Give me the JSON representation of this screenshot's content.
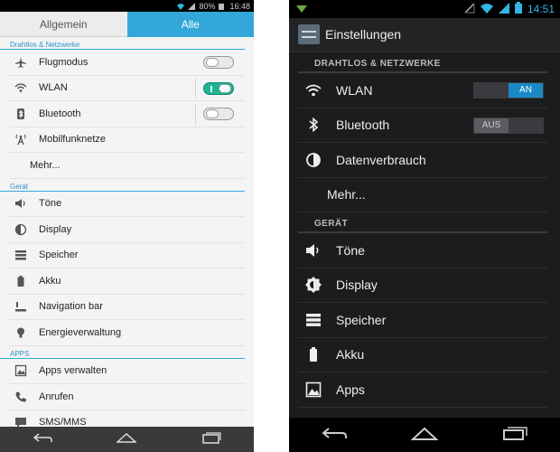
{
  "left": {
    "status": {
      "battery_percent": "80%",
      "time": "16:48"
    },
    "tabs": [
      {
        "label": "Allgemein"
      },
      {
        "label": "Alle"
      }
    ],
    "sections": {
      "network": "Drahtlos & Netzwerke",
      "device": "Gerät",
      "apps": "APPS"
    },
    "items": {
      "airplane": {
        "label": "Flugmodus",
        "icon": "airplane-icon"
      },
      "wlan": {
        "label": "WLAN",
        "icon": "wifi-icon"
      },
      "bluetooth": {
        "label": "Bluetooth",
        "icon": "bluetooth-icon"
      },
      "mobile": {
        "label": "Mobilfunknetze",
        "icon": "antenna-icon"
      },
      "more": {
        "label": "Mehr..."
      },
      "tones": {
        "label": "Töne",
        "icon": "speaker-icon"
      },
      "display": {
        "label": "Display",
        "icon": "display-icon"
      },
      "storage": {
        "label": "Speicher",
        "icon": "storage-icon"
      },
      "battery": {
        "label": "Akku",
        "icon": "battery-icon"
      },
      "navbar": {
        "label": "Navigation bar",
        "icon": "navbar-icon"
      },
      "energy": {
        "label": "Energieverwaltung",
        "icon": "bulb-icon"
      },
      "apps": {
        "label": "Apps verwalten",
        "icon": "apps-icon"
      },
      "calls": {
        "label": "Anrufen",
        "icon": "phone-icon"
      },
      "sms": {
        "label": "SMS/MMS",
        "icon": "message-icon"
      }
    }
  },
  "right": {
    "status": {
      "time": "14:51"
    },
    "title": "Einstellungen",
    "sections": {
      "network": "DRAHTLOS & NETZWERKE",
      "device": "GERÄT"
    },
    "items": {
      "wlan": {
        "label": "WLAN",
        "switch": "AN",
        "icon": "wifi-icon"
      },
      "bluetooth": {
        "label": "Bluetooth",
        "switch": "AUS",
        "icon": "bluetooth-icon"
      },
      "data": {
        "label": "Datenverbrauch",
        "icon": "data-usage-icon"
      },
      "more": {
        "label": "Mehr..."
      },
      "tones": {
        "label": "Töne",
        "icon": "speaker-icon"
      },
      "display": {
        "label": "Display",
        "icon": "brightness-icon"
      },
      "storage": {
        "label": "Speicher",
        "icon": "storage-icon"
      },
      "battery": {
        "label": "Akku",
        "icon": "battery-icon"
      },
      "apps": {
        "label": "Apps",
        "icon": "apps-icon"
      }
    }
  },
  "colors": {
    "accent_light": "#33a8d8",
    "toggle_on": "#1fb495",
    "accent_dark": "#1a8ac6"
  }
}
